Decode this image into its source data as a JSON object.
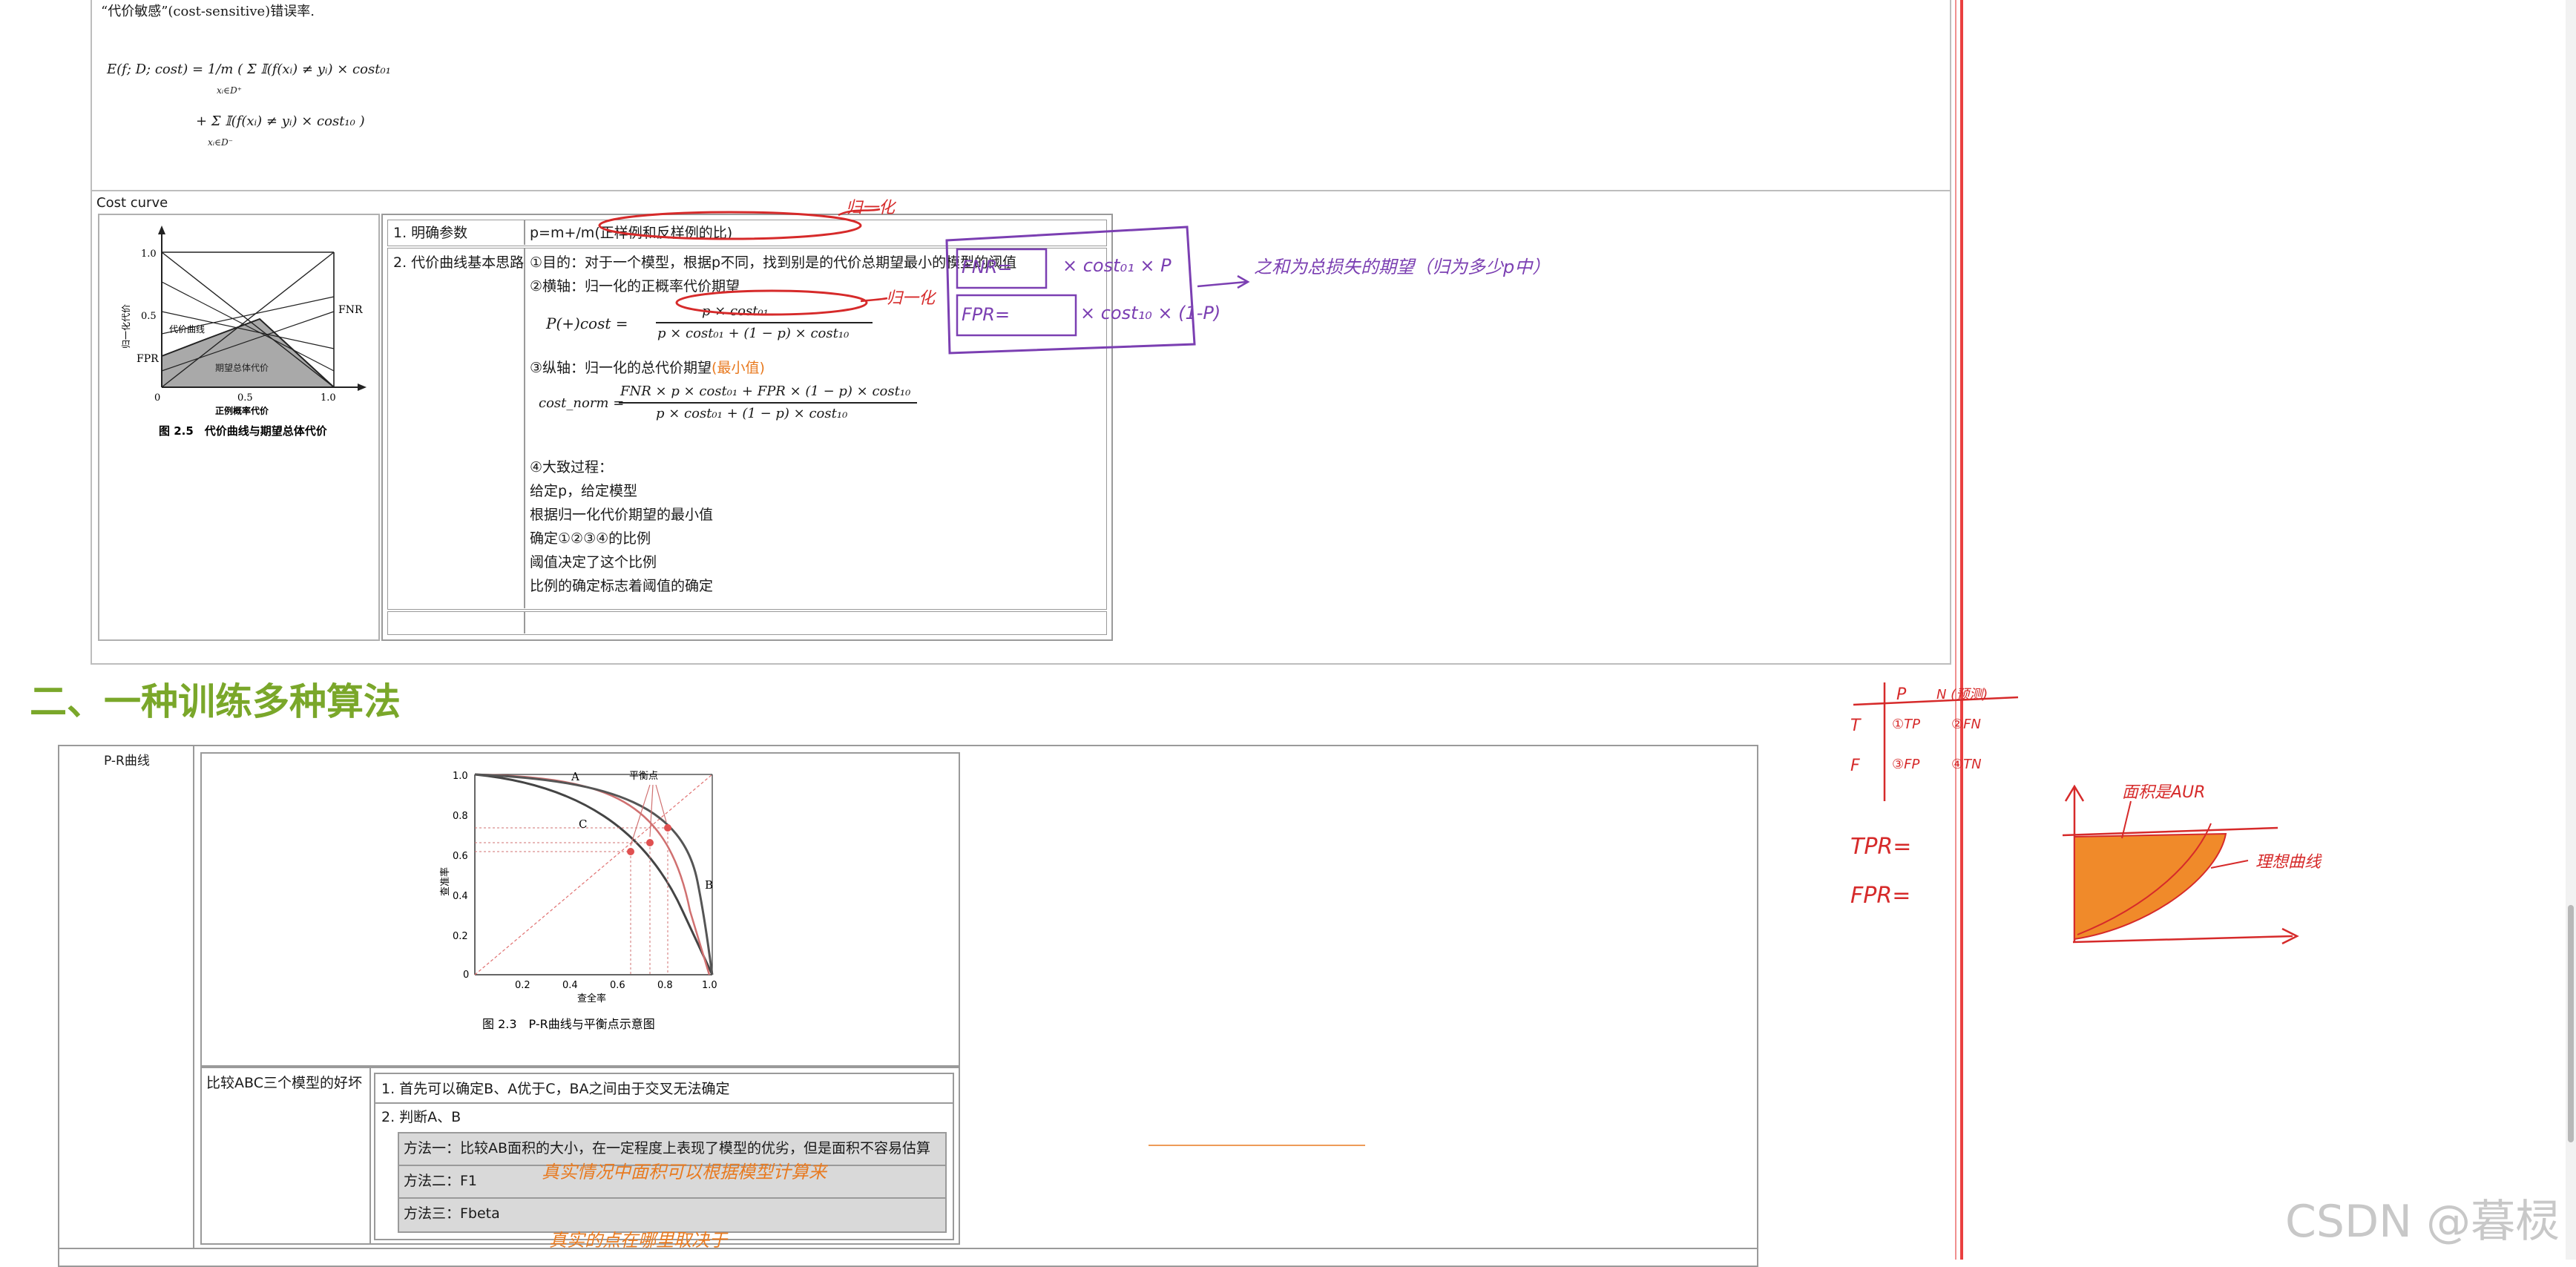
{
  "top_section": {
    "cost_sensitive_line": "“代价敏感”(cost-sensitive)错误率.",
    "formula_line1": "E(f; D; cost) = 1/m ( Σ 𝕀(f(xᵢ) ≠ yᵢ) × cost₀₁",
    "formula_line2": "+ Σ 𝕀(f(xᵢ) ≠ yᵢ) × cost₁₀ )",
    "formula_sub1": "xᵢ∈D⁺",
    "formula_sub2": "xᵢ∈D⁻"
  },
  "cost_curve": {
    "title": "Cost curve",
    "figure": {
      "ylabel": "归一化代价",
      "xlabel": "正例概率代价",
      "y_ticks": [
        "1.0",
        "0.5",
        "0"
      ],
      "x_ticks": [
        "0",
        "0.5",
        "1.0"
      ],
      "fnr_label": "FNR",
      "fpr_label": "FPR",
      "curve_label": "代价曲线",
      "area_label": "期望总体代价",
      "caption": "图 2.5　代价曲线与期望总体代价"
    },
    "rows": [
      {
        "label": "1. 明确参数",
        "content": "p=m+/m(正样例和反样例的比)"
      },
      {
        "label": "2. 代价曲线基本思路",
        "content": ""
      }
    ],
    "step1": "①目的：对于一个模型，根据p不同，找到别是的代价总期望最小的模型的阈值",
    "step2": "②横轴：归一化的正概率代价期望",
    "formula_p": "P(+)cost =",
    "formula_p_num": "p × cost₀₁",
    "formula_p_den": "p × cost₀₁ + (1 − p) × cost₁₀",
    "step3_prefix": "③纵轴：归一化的总代价期望",
    "step3_highlight": "(最小值)",
    "formula_c": "cost_norm =",
    "formula_c_num": "FNR × p × cost₀₁ + FPR × (1 − p) × cost₁₀",
    "formula_c_den": "p × cost₀₁ + (1 − p) × cost₁₀",
    "step4": "④大致过程：",
    "process": [
      "给定p，给定模型",
      "根据归一化代价期望的最小值",
      "确定①②③④的比例",
      "阈值决定了这个比例",
      "比例的确定标志着阈值的确定"
    ]
  },
  "section2": {
    "title": "二、一种训练多种算法",
    "row_label": "P-R曲线",
    "figure": {
      "ylabel": "查准率",
      "xlabel": "查全率",
      "y_ticks": [
        "1.0",
        "0.8",
        "0.6",
        "0.4",
        "0.2",
        "0"
      ],
      "x_ticks": [
        "0.2",
        "0.4",
        "0.6",
        "0.8",
        "1.0"
      ],
      "labels": [
        "A",
        "B",
        "C"
      ],
      "balance_label": "平衡点",
      "caption": "图 2.3　P-R曲线与平衡点示意图"
    },
    "compare_label": "比较ABC三个模型的好坏",
    "compare_items": [
      "1. 首先可以确定B、A优于C，BA之间由于交叉无法确定",
      "2. 判断A、B"
    ],
    "methods": [
      "方法一：比较AB面积的大小，在一定程度上表现了模型的优劣，但是面积不容易估算",
      "方法二：F1",
      "方法三：Fbeta"
    ]
  },
  "annotations": {
    "red_top": "归一化",
    "red_mid": "归一化",
    "purple_right": "之和为总损失的期望（归为多少p中）",
    "purple_fnr": "FNR=",
    "purple_fpr": "FPR=",
    "purple_mult1": "× cost₀₁ × P",
    "purple_mult2": "× cost₁₀ × (1-P)",
    "orange1": "真实情况中面积可以根据模型计算来",
    "orange2": "真实的点在哪里取决于",
    "right_table_header": [
      "P",
      "N (预测)"
    ],
    "right_table_rows": [
      [
        "T",
        "①TP",
        "②FN"
      ],
      [
        "F",
        "③FP",
        "④TN"
      ]
    ],
    "right_tpr": "TPR=",
    "right_fpr": "FPR=",
    "auc_label": "面积是AUR",
    "ideal_label": "理想曲线",
    "true_label": "真实"
  },
  "watermark": "CSDN @暮棂",
  "colors": {
    "accent_green": "#7aa72a",
    "red_ink": "#d62a2a",
    "purple_ink": "#7b3fb2",
    "orange_ink": "#e87a20",
    "orange_fill": "#f08a2a"
  }
}
